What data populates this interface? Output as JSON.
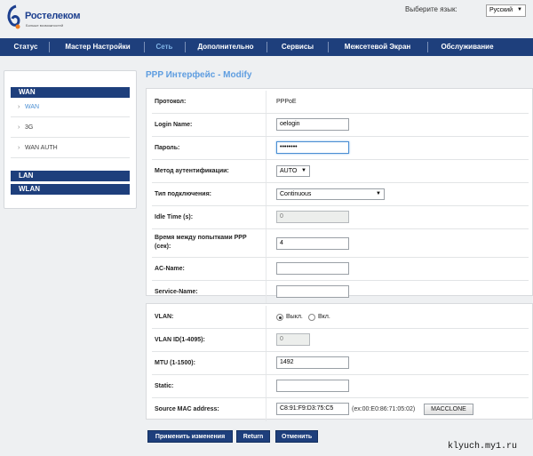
{
  "header": {
    "brand": "Ростелеком",
    "tagline": "Больше возможностей",
    "lang_label": "Выберите язык:",
    "lang_value": "Русский"
  },
  "nav": [
    {
      "label": "Статус"
    },
    {
      "label": "Мастер Настройки"
    },
    {
      "label": "Сеть",
      "active": true
    },
    {
      "label": "Дополнительно"
    },
    {
      "label": "Сервисы"
    },
    {
      "label": "Межсетевой Экран"
    },
    {
      "label": "Обслуживание"
    }
  ],
  "sidebar": {
    "wan_head": "WAN",
    "items": [
      {
        "label": "WAN",
        "active": true
      },
      {
        "label": "3G"
      },
      {
        "label": "WAN AUTH"
      }
    ],
    "lan_head": "LAN",
    "wlan_head": "WLAN"
  },
  "page": {
    "title": "PPP Интерфейс - Modify"
  },
  "form1": {
    "protocol_label": "Протокол:",
    "protocol_value": "PPPoE",
    "login_label": "Login Name:",
    "login_value": "oelogin",
    "password_label": "Пароль:",
    "password_value": "••••••••",
    "auth_label": "Метод аутентификации:",
    "auth_value": "AUTO",
    "conn_label": "Тип подключения:",
    "conn_value": "Continuous",
    "idle_label": "Idle Time (s):",
    "idle_value": "0",
    "retry_label_1": "Время между попытками PPP",
    "retry_label_2": "(сек):",
    "retry_value": "4",
    "acname_label": "AC-Name:",
    "acname_value": "",
    "service_label": "Service-Name:",
    "service_value": ""
  },
  "form2": {
    "vlan_label": "VLAN:",
    "vlan_off": "Выкл.",
    "vlan_on": "Вкл.",
    "vlanid_label": "VLAN ID(1-4095):",
    "vlanid_value": "0",
    "mtu_label": "MTU (1-1500):",
    "mtu_value": "1492",
    "static_label": "Static:",
    "static_value": "",
    "mac_label": "Source MAC address:",
    "mac_value": "C8:91:F9:D3:75:C5",
    "mac_example": "(ex:00:E0:86:71:05:02)",
    "macclone_label": "MACCLONE"
  },
  "actions": {
    "apply": "Применить изменения",
    "return": "Return",
    "cancel": "Отменить"
  },
  "watermark": "klyuch.my1.ru",
  "colors": {
    "nav_bg": "#1e3f7c",
    "accent": "#5e9de0",
    "page_bg": "#eef0f2"
  }
}
